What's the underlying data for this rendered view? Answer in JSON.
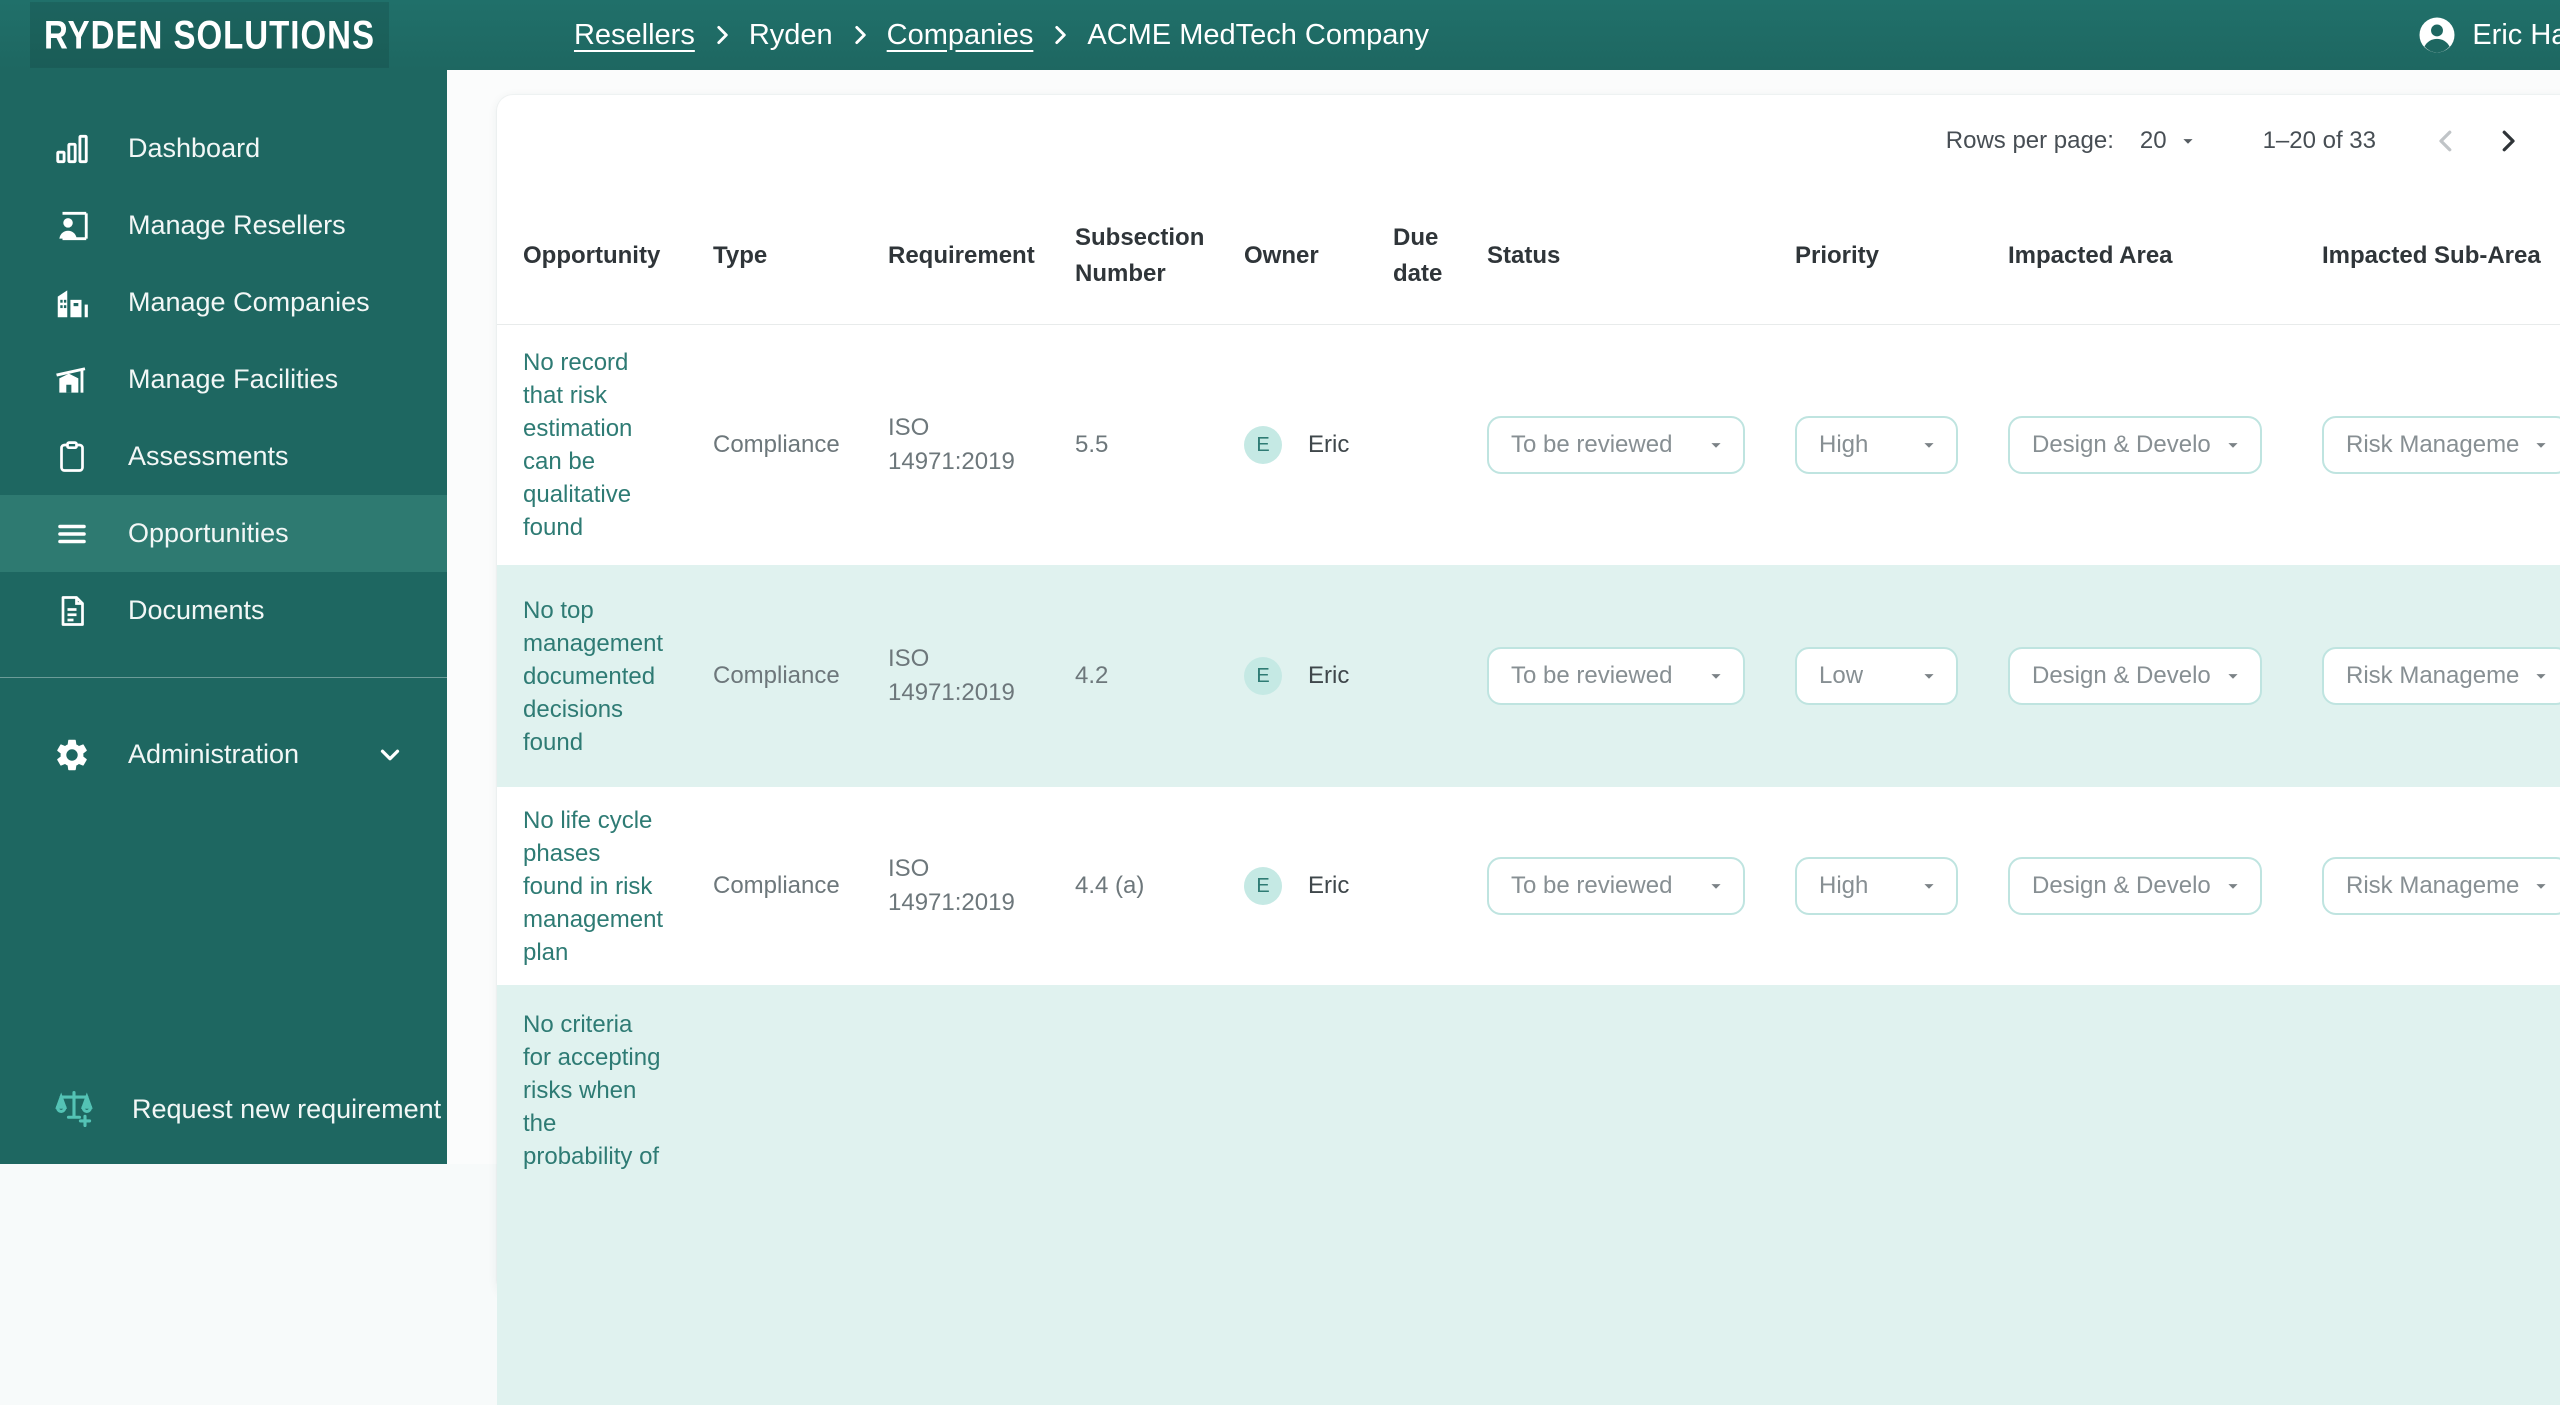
{
  "brand": "RYDEN SOLUTIONS",
  "breadcrumb": {
    "separator": "chevron-right",
    "items": [
      {
        "label": "Resellers",
        "link": true
      },
      {
        "label": "Ryden",
        "link": false
      },
      {
        "label": "Companies",
        "link": true
      },
      {
        "label": "ACME MedTech Company",
        "link": false
      }
    ]
  },
  "user": {
    "name": "Eric Hani",
    "icon": "account-circle-icon"
  },
  "sidebar": {
    "items": [
      {
        "label": "Dashboard",
        "icon": "bar-chart-icon",
        "active": false
      },
      {
        "label": "Manage Resellers",
        "icon": "person-card-icon",
        "active": false
      },
      {
        "label": "Manage Companies",
        "icon": "building-icon",
        "active": false
      },
      {
        "label": "Manage Facilities",
        "icon": "facility-icon",
        "active": false
      },
      {
        "label": "Assessments",
        "icon": "clipboard-icon",
        "active": false
      },
      {
        "label": "Opportunities",
        "icon": "list-icon",
        "active": true
      },
      {
        "label": "Documents",
        "icon": "document-icon",
        "active": false
      }
    ],
    "admin": {
      "label": "Administration",
      "icon": "gear-icon",
      "chevron": "chevron-down-icon"
    },
    "footer": {
      "label": "Request new requirement",
      "icon": "scales-plus-icon",
      "icon_color": "#54c3b5"
    }
  },
  "pagination": {
    "rows_per_page_label": "Rows per page:",
    "rows_per_page_value": "20",
    "range": "1–20 of 33",
    "prev_enabled": false,
    "next_enabled": true
  },
  "table": {
    "columns": [
      "Opportunity",
      "Type",
      "Requirement",
      "Subsection Number",
      "Owner",
      "Due date",
      "Status",
      "Priority",
      "Impacted Area",
      "Impacted Sub-Area"
    ],
    "rows": [
      {
        "opportunity": "No record that risk estimation can be qualitative found",
        "type": "Compliance",
        "requirement": "ISO 14971:2019",
        "subsection": "5.5",
        "owner_initial": "E",
        "owner": "Eric",
        "due_date": "",
        "status": "To be reviewed",
        "priority": "High",
        "impacted_area": "Design & Develo...",
        "impacted_sub_area": "Risk Manageme..."
      },
      {
        "opportunity": "No top management documented decisions found",
        "type": "Compliance",
        "requirement": "ISO 14971:2019",
        "subsection": "4.2",
        "owner_initial": "E",
        "owner": "Eric",
        "due_date": "",
        "status": "To be reviewed",
        "priority": "Low",
        "impacted_area": "Design & Develo...",
        "impacted_sub_area": "Risk Manageme..."
      },
      {
        "opportunity": "No life cycle phases found in risk management plan",
        "type": "Compliance",
        "requirement": "ISO 14971:2019",
        "subsection": "4.4 (a)",
        "owner_initial": "E",
        "owner": "Eric",
        "due_date": "",
        "status": "To be reviewed",
        "priority": "High",
        "impacted_area": "Design & Develo...",
        "impacted_sub_area": "Risk Manageme..."
      },
      {
        "opportunity": "No criteria for accepting risks when the probability of"
      }
    ]
  },
  "colors": {
    "sidebar_teal": "#1e6761",
    "active_item_teal": "#2e7a71",
    "mint_row": "#e0f2ef",
    "link_teal": "#2e7b74",
    "dropdown_border": "#bfe4e0",
    "accent_mint": "#54c3b5"
  }
}
